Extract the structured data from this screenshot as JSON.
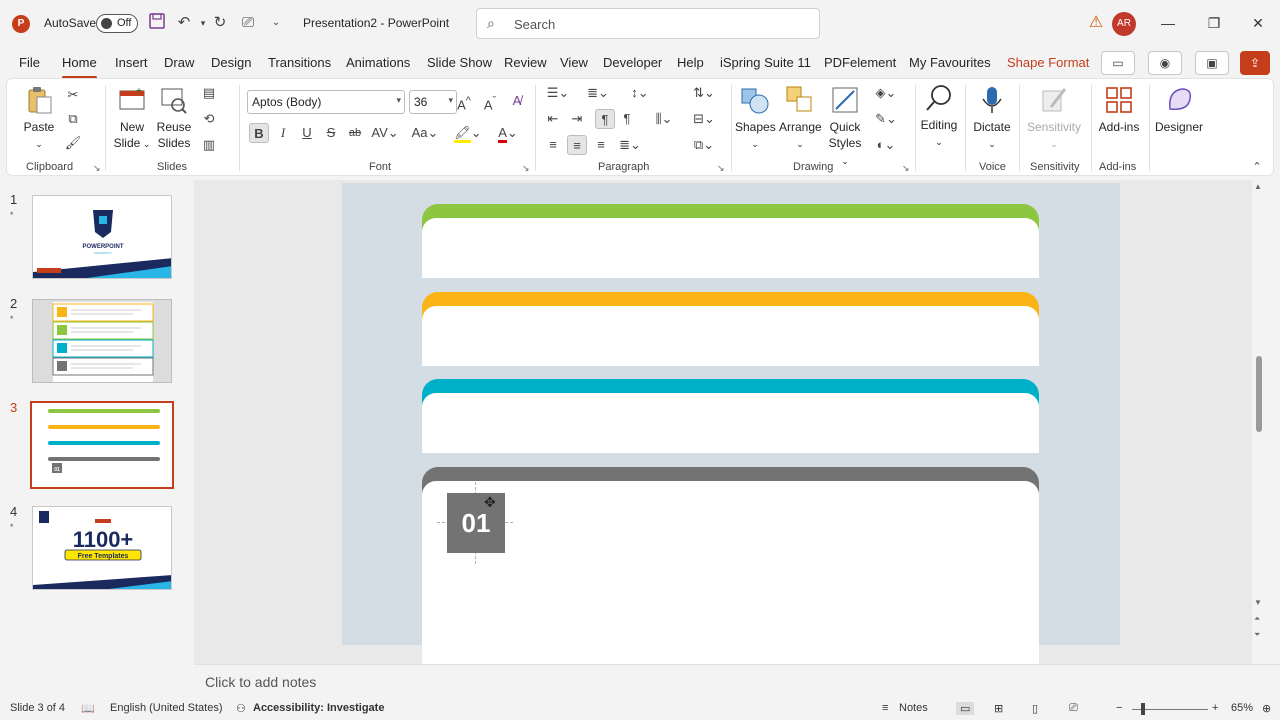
{
  "titlebar": {
    "autosave_label": "AutoSave",
    "autosave_state": "Off",
    "doc_title": "Presentation2  -  PowerPoint",
    "search_placeholder": "Search",
    "avatar_initials": "AR",
    "app_logo": "P"
  },
  "menu": {
    "tabs": [
      "File",
      "Home",
      "Insert",
      "Draw",
      "Design",
      "Transitions",
      "Animations",
      "Slide Show",
      "Review",
      "View",
      "Developer",
      "Help",
      "iSpring Suite 11",
      "PDFelement",
      "My Favourites",
      "Shape Format"
    ],
    "active": "Home"
  },
  "ribbon": {
    "clipboard": {
      "label": "Clipboard",
      "paste": "Paste"
    },
    "slides": {
      "label": "Slides",
      "new_slide": [
        "New",
        "Slide"
      ],
      "reuse_slides": [
        "Reuse",
        "Slides"
      ]
    },
    "font": {
      "label": "Font",
      "family": "Aptos (Body)",
      "size": "36"
    },
    "paragraph": {
      "label": "Paragraph"
    },
    "drawing": {
      "label": "Drawing",
      "shapes": "Shapes",
      "arrange": "Arrange",
      "quick_styles": [
        "Quick",
        "Styles"
      ]
    },
    "editing": {
      "label": "Editing"
    },
    "voice": {
      "label": "Voice",
      "dictate": "Dictate"
    },
    "sensitivity": {
      "label": "Sensitivity",
      "button": "Sensitivity"
    },
    "addins": {
      "label": "Add-ins",
      "button": "Add-ins"
    },
    "designer": {
      "button": "Designer"
    }
  },
  "thumbnails": [
    {
      "num": "1",
      "star": "*"
    },
    {
      "num": "2",
      "star": "*"
    },
    {
      "num": "3",
      "star": ""
    },
    {
      "num": "4",
      "star": "*"
    }
  ],
  "thumb_texts": {
    "t1_title": "POWERPOINT",
    "t1_sub": "UNIVERSITY",
    "t3_badge": "01",
    "t4_big": "1100+",
    "t4_sub": "Free Templates"
  },
  "slide": {
    "badge_text": "01",
    "card_colors": [
      "#8dc63f",
      "#fbb315",
      "#00b0c8",
      "#737373"
    ]
  },
  "notes": {
    "placeholder": "Click to add notes"
  },
  "status": {
    "slide_info": "Slide 3 of 4",
    "language": "English (United States)",
    "accessibility": "Accessibility: Investigate",
    "notes_btn": "Notes",
    "zoom": "65%"
  },
  "colors": {
    "accent": "#c43e1c"
  }
}
